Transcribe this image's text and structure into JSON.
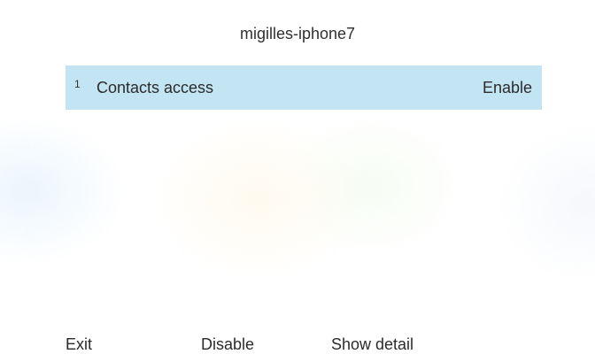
{
  "header": {
    "title": "migilles-iphone7"
  },
  "list": {
    "items": [
      {
        "index": "1",
        "label": "Contacts access",
        "value": "Enable",
        "selected": true
      }
    ]
  },
  "softkeys": {
    "exit": "Exit",
    "disable": "Disable",
    "show_detail": "Show detail"
  },
  "colors": {
    "selected_row": "#c3e4f3",
    "text": "#2b2b2b",
    "background": "#ffffff"
  }
}
